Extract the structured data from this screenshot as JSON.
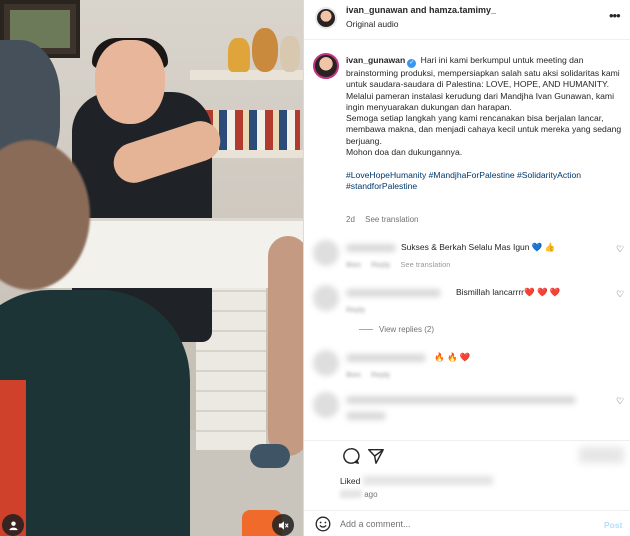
{
  "header": {
    "username": "ivan_gunawan and hamza.tamimy_",
    "audio": "Original audio",
    "more_icon": "more-horizontal-icon"
  },
  "caption": {
    "username": "ivan_gunawan",
    "verified_icon": "verified-badge-icon",
    "line1": "Hari ini kami berkumpul untuk meeting dan brainstorming produksi, mempersiapkan salah satu aksi solidaritas kami untuk saudara-saudara di Palestina: LOVE, HOPE, AND HUMANITY.",
    "line2": "Melalui pameran instalasi kerudung dari Mandjha Ivan Gunawan, kami ingin menyuarakan dukungan dan harapan.",
    "line3": "Semoga setiap langkah yang kami rencanakan bisa berjalan lancar, membawa makna, dan menjadi cahaya kecil untuk mereka yang sedang berjuang.",
    "line4": "Mohon doa dan dukungannya.",
    "hashtags": "#LoveHopeHumanity #MandjhaForPalestine #SolidarityAction #standforPalestine",
    "time": "2d",
    "see_translation": "See translation"
  },
  "comments": [
    {
      "text": "Sukses & Berkah Selalu Mas Igun 💙 👍",
      "likes": "likes",
      "reply": "Reply",
      "see_translation": "See translation"
    },
    {
      "text": "Bismillah lancarrrr❤️ ❤️ ❤️",
      "reply": "Reply",
      "view_replies": "View replies (2)"
    },
    {
      "text": "🔥 🔥 ❤️",
      "likes": "likes",
      "reply": "Reply"
    }
  ],
  "actions": {
    "comment_icon": "comment-bubble-icon",
    "share_icon": "send-paper-plane-icon",
    "liked_prefix": "Liked",
    "ago": "ago"
  },
  "add_comment": {
    "emoji_icon": "emoji-smile-icon",
    "placeholder": "Add a comment...",
    "post_label": "Post"
  },
  "media": {
    "user_tag_icon": "user-tag-icon",
    "mute_icon": "muted-speaker-icon"
  },
  "colors": {
    "link": "#00376b",
    "meta": "#737373",
    "post_disabled": "#b2dffc",
    "verified": "#3897f0"
  }
}
